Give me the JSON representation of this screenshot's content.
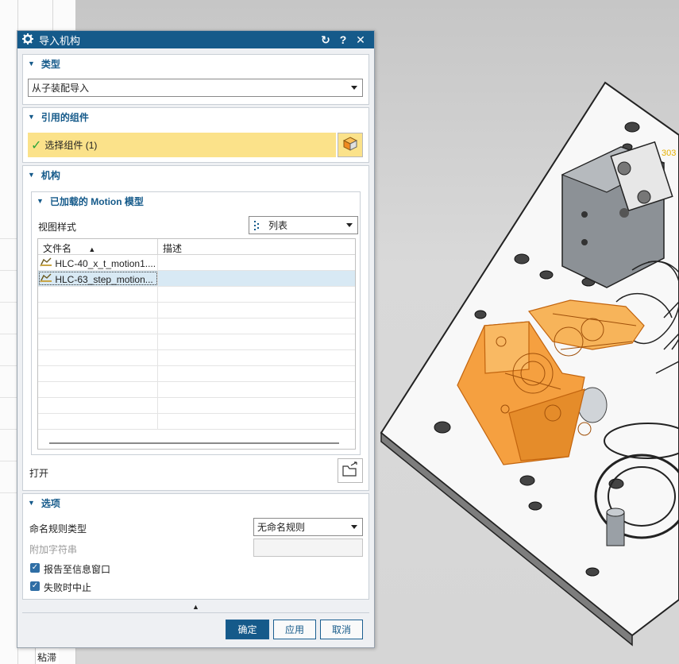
{
  "dialog": {
    "title": "导入机构",
    "reset_icon": "↻",
    "help_icon": "?",
    "close_icon": "✕"
  },
  "type_section": {
    "header": "类型",
    "selected": "从子装配导入"
  },
  "components_section": {
    "header": "引用的组件",
    "select_label": "选择组件 (1)"
  },
  "mechanism_section": {
    "header": "机构",
    "loaded_header": "已加载的 Motion 模型",
    "view_style_label": "视图样式",
    "view_style_value": "列表",
    "columns": [
      "文件名",
      "描述"
    ],
    "rows": [
      {
        "name": "HLC-40_x_t_motion1....",
        "desc": ""
      },
      {
        "name": "HLC-63_step_motion...",
        "desc": ""
      }
    ],
    "open_label": "打开"
  },
  "options_section": {
    "header": "选项",
    "naming_rule_label": "命名规则类型",
    "naming_rule_value": "无命名规则",
    "append_string_label": "附加字符串",
    "report_label": "报告至信息窗口",
    "stop_on_fail_label": "失败时中止"
  },
  "footer": {
    "ok": "确定",
    "apply": "应用",
    "cancel": "取消"
  },
  "background": {
    "bottom_tab": "粘滞",
    "edge_text": "303"
  },
  "colors": {
    "title_bar": "#155a8a",
    "highlight": "#fbe28a",
    "selected_part": "#f5a040"
  }
}
